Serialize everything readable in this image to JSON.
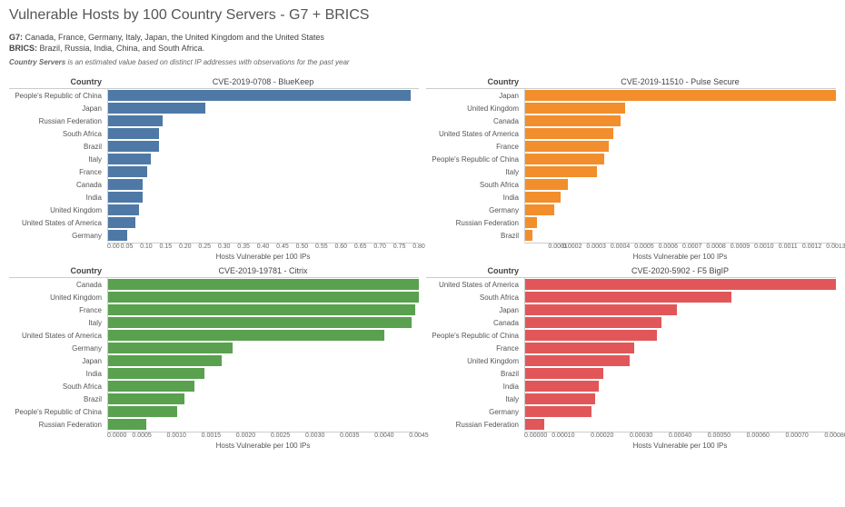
{
  "header": {
    "title": "Vulnerable Hosts by 100 Country Servers - G7 + BRICS",
    "g7_label": "G7:",
    "g7_text": "Canada, France, Germany, Italy, Japan, the United Kingdom and the United States",
    "brics_label": "BRICS:",
    "brics_text": "Brazil, Russia, India, China, and South Africa.",
    "note_em": "Country Servers",
    "note_rest": " is an estimated value based on distinct IP addresses with observations for the past year"
  },
  "common": {
    "col_header": "Country",
    "x_axis_label": "Hosts Vulnerable per 100 IPs"
  },
  "chart_data": [
    {
      "type": "bar",
      "title": "CVE-2019-0708 - BlueKeep",
      "color_class": "c-blue",
      "xlabel": "Hosts Vulnerable per 100 IPs",
      "ylabel": "Country",
      "xlim": [
        0,
        0.8
      ],
      "ticks": [
        "0.00",
        "0.05",
        "0.10",
        "0.15",
        "0.20",
        "0.25",
        "0.30",
        "0.35",
        "0.40",
        "0.45",
        "0.50",
        "0.55",
        "0.60",
        "0.65",
        "0.70",
        "0.75",
        "0.80"
      ],
      "categories": [
        "People's Republic of China",
        "Japan",
        "Russian Federation",
        "South Africa",
        "Brazil",
        "Italy",
        "France",
        "Canada",
        "India",
        "United Kingdom",
        "United States of America",
        "Germany"
      ],
      "values": [
        0.78,
        0.25,
        0.14,
        0.13,
        0.13,
        0.11,
        0.1,
        0.09,
        0.09,
        0.08,
        0.07,
        0.05
      ]
    },
    {
      "type": "bar",
      "title": "CVE-2019-11510 - Pulse Secure",
      "color_class": "c-orange",
      "xlabel": "Hosts Vulnerable per 100 IPs",
      "ylabel": "Country",
      "xlim": [
        0,
        0.0013
      ],
      "ticks": [
        "0.0001",
        "0.0002",
        "0.0003",
        "0.0004",
        "0.0005",
        "0.0006",
        "0.0007",
        "0.0008",
        "0.0009",
        "0.0010",
        "0.0011",
        "0.0012",
        "0.0013"
      ],
      "categories": [
        "Japan",
        "United Kingdom",
        "Canada",
        "United States of America",
        "France",
        "People's Republic of China",
        "Italy",
        "South Africa",
        "India",
        "Germany",
        "Russian Federation",
        "Brazil"
      ],
      "values": [
        0.0013,
        0.00042,
        0.0004,
        0.00037,
        0.00035,
        0.00033,
        0.0003,
        0.00018,
        0.00015,
        0.00012,
        5e-05,
        3e-05
      ]
    },
    {
      "type": "bar",
      "title": "CVE-2019-19781 - Citrix",
      "color_class": "c-green",
      "xlabel": "Hosts Vulnerable per 100 IPs",
      "ylabel": "Country",
      "xlim": [
        0,
        0.0045
      ],
      "ticks": [
        "0.0000",
        "0.0005",
        "0.0010",
        "0.0015",
        "0.0020",
        "0.0025",
        "0.0030",
        "0.0035",
        "0.0040",
        "0.0045"
      ],
      "categories": [
        "Canada",
        "United Kingdom",
        "France",
        "Italy",
        "United States of America",
        "Germany",
        "Japan",
        "India",
        "South Africa",
        "Brazil",
        "People's Republic of China",
        "Russian Federation"
      ],
      "values": [
        0.0046,
        0.00455,
        0.00445,
        0.0044,
        0.004,
        0.0018,
        0.00165,
        0.0014,
        0.00125,
        0.0011,
        0.001,
        0.00055
      ]
    },
    {
      "type": "bar",
      "title": "CVE-2020-5902 - F5 BigIP",
      "color_class": "c-red",
      "xlabel": "Hosts Vulnerable per 100 IPs",
      "ylabel": "Country",
      "xlim": [
        0,
        0.0008
      ],
      "ticks": [
        "0.00000",
        "0.00010",
        "0.00020",
        "0.00030",
        "0.00040",
        "0.00050",
        "0.00060",
        "0.00070",
        "0.00080"
      ],
      "categories": [
        "United States of America",
        "South Africa",
        "Japan",
        "Canada",
        "People's Republic of China",
        "France",
        "United Kingdom",
        "Brazil",
        "India",
        "Italy",
        "Germany",
        "Russian Federation"
      ],
      "values": [
        0.0008,
        0.00053,
        0.00039,
        0.00035,
        0.00034,
        0.00028,
        0.00027,
        0.0002,
        0.00019,
        0.00018,
        0.00017,
        5e-05
      ]
    }
  ]
}
